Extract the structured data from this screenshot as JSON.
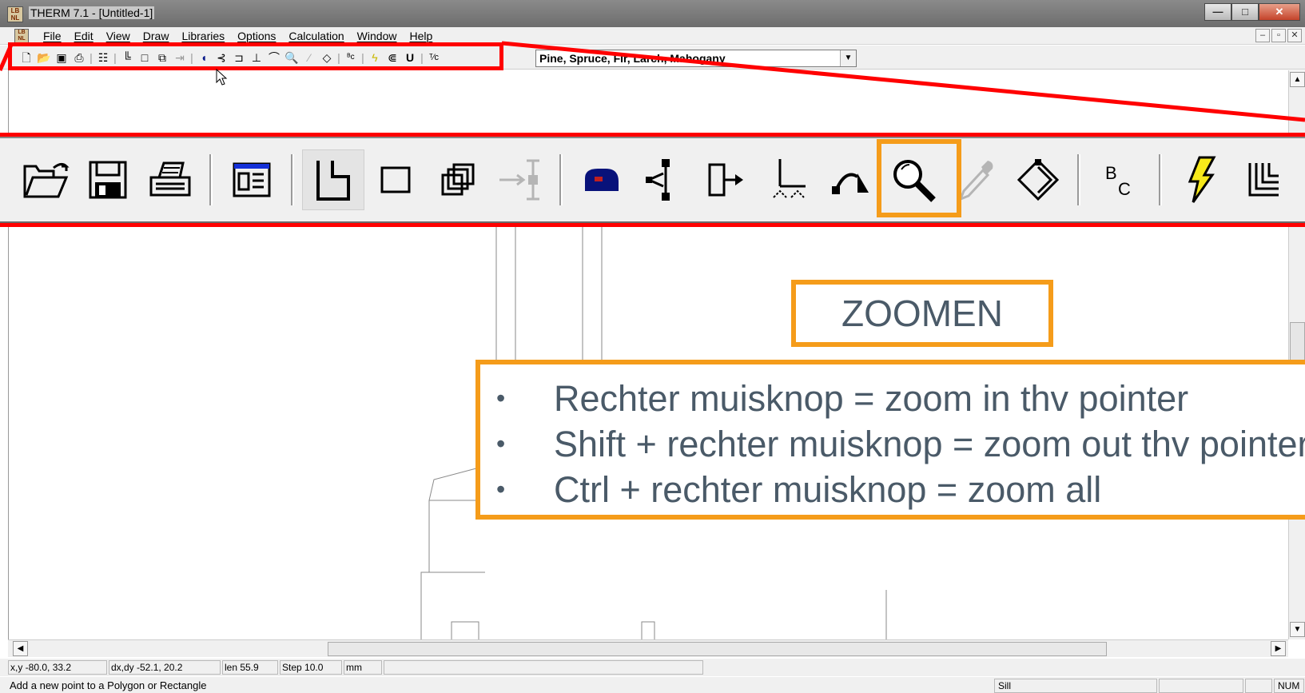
{
  "window": {
    "title": "THERM 7.1 - [Untitled-1]",
    "controls": {
      "minimize": "—",
      "maximize": "□",
      "close": "✕"
    }
  },
  "menubar": {
    "items": [
      "File",
      "Edit",
      "View",
      "Draw",
      "Libraries",
      "Options",
      "Calculation",
      "Window",
      "Help"
    ],
    "mdi_controls": {
      "minimize": "–",
      "restore": "▫",
      "close": "✕"
    }
  },
  "toolbar": {
    "material_select": {
      "value": "Pine, Spruce, Fir, Larch, Mahogany"
    },
    "small_icons": [
      "new-file-icon",
      "open-folder-icon",
      "save-icon",
      "print-icon",
      "properties-icon",
      "polygon-icon",
      "rectangle-icon",
      "fill-icon",
      "insert-point-icon",
      "material-icon",
      "locate-icon",
      "offset-icon",
      "dimension-icon",
      "arc-icon",
      "zoom-icon",
      "eyedropper-icon",
      "rotate-icon",
      "boundary-conditions-icon",
      "calculate-icon",
      "results-icon",
      "u-factor-icon",
      "text-fraction-icon"
    ],
    "highlighted_tool": "zoom-icon"
  },
  "annotations": {
    "zoom_title": "ZOOMEN",
    "bullets": [
      "Rechter muisknop = zoom in thv pointer",
      "Shift + rechter muisknop = zoom out thv pointer",
      "Ctrl + rechter muisknop =  zoom all"
    ],
    "highlight_color": "#f59c1a",
    "callout_color": "#ff0000"
  },
  "statusbar": {
    "xy": "x,y -80.0, 33.2",
    "dxdy": "dx,dy -52.1, 20.2",
    "len": "len  55.9",
    "step": "Step  10.0",
    "units": "mm",
    "hint": "Add a new point to a Polygon or Rectangle",
    "mode": "Sill",
    "num": "NUM"
  }
}
